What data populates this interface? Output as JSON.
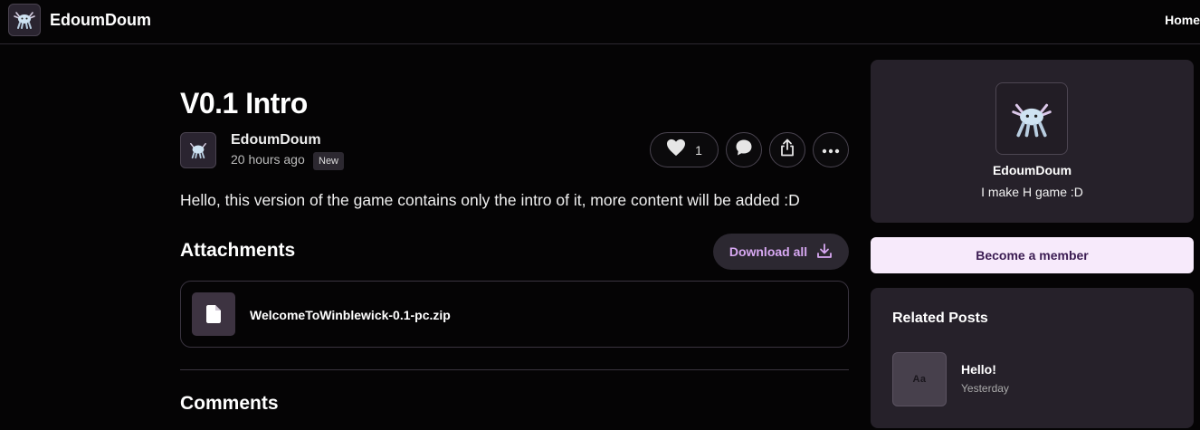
{
  "header": {
    "brand": "EdoumDoum",
    "nav_home": "Home",
    "logo_icon": "axolotl-logo-icon"
  },
  "post": {
    "title": "V0.1 Intro",
    "author": "EdoumDoum",
    "time": "20 hours ago",
    "badge": "New",
    "like_count": "1",
    "body": "Hello, this version of the game contains only the intro of it, more content will be added :D",
    "actions": [
      "heart-icon",
      "comment-icon",
      "share-icon",
      "more-icon"
    ]
  },
  "attachments": {
    "heading": "Attachments",
    "download_all": "Download all",
    "files": [
      {
        "name": "WelcomeToWinblewick-0.1-pc.zip",
        "icon": "file-icon"
      }
    ]
  },
  "comments": {
    "heading": "Comments"
  },
  "sidebar": {
    "profile": {
      "name": "EdoumDoum",
      "bio": "I make H game :D"
    },
    "member_button": "Become a member",
    "related": {
      "heading": "Related Posts",
      "items": [
        {
          "title": "Hello!",
          "date": "Yesterday",
          "thumb_text": "Aa"
        }
      ]
    }
  },
  "colors": {
    "background": "#050405",
    "card": "#26212a",
    "accent": "#d7a8f2",
    "member_button_bg": "#f7eafb"
  }
}
